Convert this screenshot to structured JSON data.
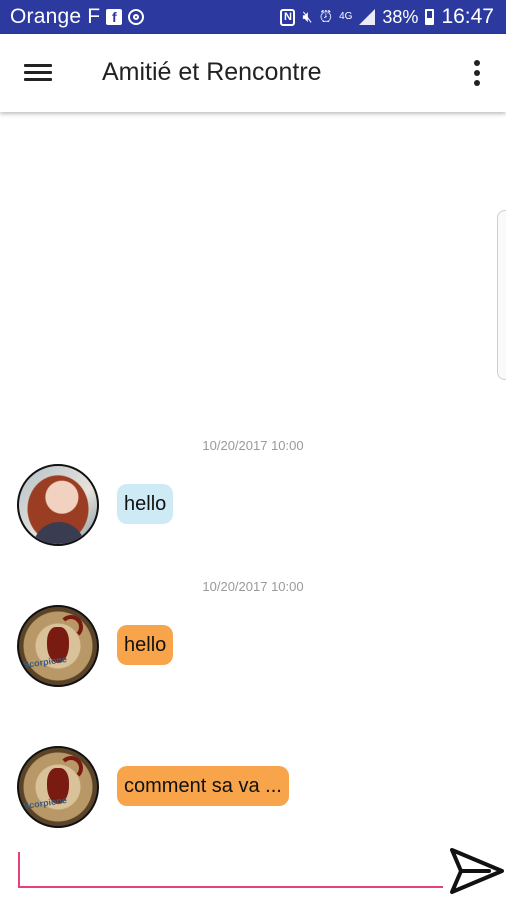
{
  "status_bar": {
    "carrier": "Orange F",
    "network": "4G",
    "battery": "38%",
    "battery_level": 0.38,
    "time": "16:47",
    "background_color": "#2c3aa0"
  },
  "app_bar": {
    "title": "Amitié et Rencontre",
    "menu_icon": "hamburger-menu-icon",
    "overflow_icon": "more-vertical-icon"
  },
  "messages": [
    {
      "timestamp": "10/20/2017 10:00",
      "text": "hello",
      "avatar": "woman-portrait",
      "bubble_color": "#cdeaf5"
    },
    {
      "timestamp": "10/20/2017 10:00",
      "text": "hello",
      "avatar": "scorpion-image",
      "bubble_color": "#f7a44b"
    },
    {
      "text": "comment sa va ...",
      "avatar": "scorpion-image",
      "bubble_color": "#f7a44b"
    }
  ],
  "composer": {
    "value": "",
    "underline_color": "#e8407a",
    "send_icon": "send-arrow-icon"
  }
}
